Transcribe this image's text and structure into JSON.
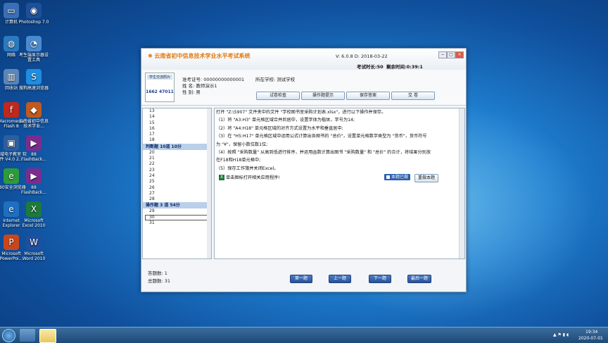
{
  "desktop": {
    "icons": [
      {
        "label": "计算机",
        "glyph": "▭",
        "color": "#3b6fb5"
      },
      {
        "label": "Photoshop 7.0",
        "glyph": "◉",
        "color": "#1e4f9a"
      },
      {
        "label": "网络",
        "glyph": "◍",
        "color": "#2a7ac0"
      },
      {
        "label": "考生端显示器设置工具",
        "glyph": "◔",
        "color": "#4a8bd0"
      },
      {
        "label": "回收站",
        "glyph": "▥",
        "color": "#5a86b8"
      },
      {
        "label": "搜狗高速浏览器",
        "glyph": "S",
        "color": "#1f8de0"
      },
      {
        "label": "Macromedia Flash 8",
        "glyph": "f",
        "color": "#c0281e"
      },
      {
        "label": "云南省初中信息技术学业...",
        "glyph": "◆",
        "color": "#c05a1e"
      },
      {
        "label": "极域电子教室 软件 V4.0 2...",
        "glyph": "▣",
        "color": "#2c5f9e"
      },
      {
        "label": "88 FlashBack...",
        "glyph": "▶",
        "color": "#7a2d8e"
      },
      {
        "label": "360安全浏览器",
        "glyph": "e",
        "color": "#2e9b3a"
      },
      {
        "label": "88 FlashBack...",
        "glyph": "▶",
        "color": "#7a2d8e"
      },
      {
        "label": "Internet Explorer",
        "glyph": "e",
        "color": "#1e6fc0"
      },
      {
        "label": "Microsoft Excel 2010",
        "glyph": "X",
        "color": "#1d7a3a"
      },
      {
        "label": "Microsoft PowerPoi...",
        "glyph": "P",
        "color": "#c8461e"
      },
      {
        "label": "Microsoft Word 2010",
        "glyph": "W",
        "color": "#1f4f9e"
      }
    ]
  },
  "window": {
    "title": "云南省初中信息技术学业水平考试系统",
    "version": "V: 6.0.8  D: 2018-03-22",
    "exam_duration": "考试时长:50",
    "remaining_time": "剩余时间:0:39:1",
    "controls": {
      "minimize": "−",
      "maximize": "□",
      "close": "×"
    }
  },
  "student": {
    "photo_title": "学生交流照片",
    "photo_number": "1662 47011",
    "ticket": "准考证号: 00000000000001",
    "name": "姓     名: 教师演示1",
    "gender": "性     别: 男",
    "school": "所在学校: 测试学校"
  },
  "toolbar": {
    "check_paper": "试卷检查",
    "op_hint": "操作题提示",
    "save_answer": "保存答案",
    "submit": "交   卷"
  },
  "question_list": {
    "group1_items": [
      "13",
      "14",
      "15",
      "16",
      "17",
      "18"
    ],
    "section1": "判断题 10道 10分",
    "group2_items": [
      "20",
      "21",
      "22",
      "23",
      "24",
      "25",
      "26",
      "27",
      "28"
    ],
    "section2": "操作题 3 道 54分",
    "group3_items": [
      "29",
      "30",
      "31"
    ],
    "selected": "30"
  },
  "question": {
    "lines": [
      "打开 \"Z:\\5907\" 文件夹中的文件 \"学校图书室采购计划表.xlsx\"，进行以下操作并保存。",
      "（1）将 \"A3:H3\" 单元格区域合并后居中，设置字体为楷体，字号为14;",
      "（2）将 \"A4:H18\" 单元格区域的对齐方式设置为水平和垂直居中;",
      "（3）在 \"H5:H17\" 单元格区域中运用公式计算出各图书的 \"总价\"，设置单元格数字类型为 \"货币\"，货币符号",
      "为 \"¥\"，保留小数位数1位;",
      "（4）按照 \"采购数量\" 从高到低进行排序，并运用函数计算出图书 \"采购数量\" 和 \"总价\" 的合计，将结果分别放",
      "在F18和H18单元格中;",
      "（5）保存工作簿并关闭Excel。"
    ],
    "open_app_hint": "单击图标打开相关应用程序!",
    "done_checkbox": "本题已做",
    "redo_button": "重做本题"
  },
  "footer": {
    "answered": "答题数: 1",
    "total": "总题数: 31",
    "first": "第一题",
    "prev": "上一题",
    "next": "下一题",
    "last": "最后一题"
  },
  "taskbar": {
    "time": "19:34",
    "date": "2020-07-01",
    "tray_icons": "▲ ⚑ ▮ ◖"
  }
}
